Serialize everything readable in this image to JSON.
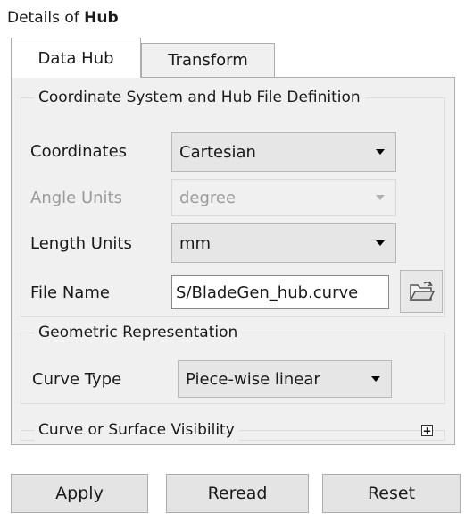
{
  "header": {
    "prefix": "Details of",
    "object": "Hub"
  },
  "tabs": [
    {
      "label": "Data Hub",
      "active": true
    },
    {
      "label": "Transform",
      "active": false
    }
  ],
  "groups": {
    "coordinate_system": {
      "title": "Coordinate System and Hub File Definition",
      "coordinates": {
        "label": "Coordinates",
        "value": "Cartesian"
      },
      "angle_units": {
        "label": "Angle Units",
        "value": "degree",
        "disabled": true
      },
      "length_units": {
        "label": "Length Units",
        "value": "mm"
      },
      "file_name": {
        "label": "File Name",
        "value": "S/BladeGen_hub.curve"
      }
    },
    "geometric_representation": {
      "title": "Geometric Representation",
      "curve_type": {
        "label": "Curve Type",
        "value": "Piece-wise linear"
      }
    },
    "visibility": {
      "title": "Curve or Surface Visibility",
      "expand_symbol": "+"
    }
  },
  "buttons": {
    "apply": "Apply",
    "reread": "Reread",
    "reset": "Reset"
  },
  "icons": {
    "browse": "open-folder-icon",
    "expand": "expand-plus-icon",
    "dropdown": "chevron-down-icon"
  },
  "colors": {
    "panel_bg": "#f0f0f0",
    "border": "#adadad",
    "disabled_text": "#9a9a9a"
  }
}
